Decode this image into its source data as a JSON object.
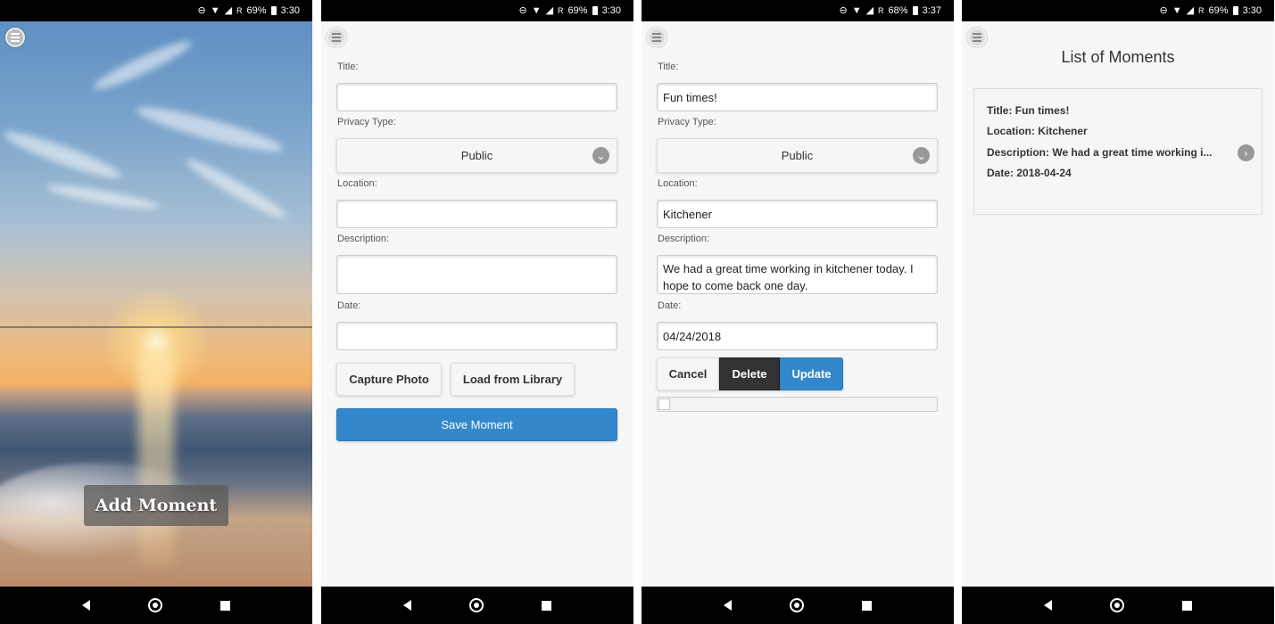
{
  "status_bars": [
    {
      "battery": "69%",
      "time": "3:30",
      "roaming": "R"
    },
    {
      "battery": "69%",
      "time": "3:30",
      "roaming": "R"
    },
    {
      "battery": "68%",
      "time": "3:37",
      "roaming": "R"
    },
    {
      "battery": "69%",
      "time": "3:30",
      "roaming": "R"
    }
  ],
  "home": {
    "add_moment_label": "Add Moment"
  },
  "add_form": {
    "title_label": "Title:",
    "title_value": "",
    "privacy_label": "Privacy Type:",
    "privacy_value": "Public",
    "location_label": "Location:",
    "location_value": "",
    "description_label": "Description:",
    "description_value": "",
    "date_label": "Date:",
    "date_value": "",
    "capture_photo_label": "Capture Photo",
    "load_library_label": "Load from Library",
    "save_label": "Save Moment"
  },
  "edit_form": {
    "title_label": "Title:",
    "title_value": "Fun times!",
    "privacy_label": "Privacy Type:",
    "privacy_value": "Public",
    "location_label": "Location:",
    "location_value": "Kitchener",
    "description_label": "Description:",
    "description_value": "We had a great time working in kitchener today. I hope to come back one day.",
    "date_label": "Date:",
    "date_value": "04/24/2018",
    "cancel_label": "Cancel",
    "delete_label": "Delete",
    "update_label": "Update",
    "progress": 0
  },
  "list": {
    "heading": "List of Moments",
    "items": [
      {
        "title": "Title: Fun times!",
        "location": "Location: Kitchener",
        "description": "Description: We had a great time working i...",
        "date": "Date: 2018-04-24"
      }
    ]
  },
  "icons": {
    "menu": "hamburger-menu-icon",
    "select": "chevron-down-circle-icon",
    "list_item": "chevron-right-circle-icon",
    "nav_back": "back-triangle-icon",
    "nav_home": "home-circle-icon",
    "nav_recent": "recent-apps-square-icon"
  },
  "colors": {
    "primary": "#3388cc",
    "dark_button": "#333333",
    "status_bar": "#000000"
  }
}
